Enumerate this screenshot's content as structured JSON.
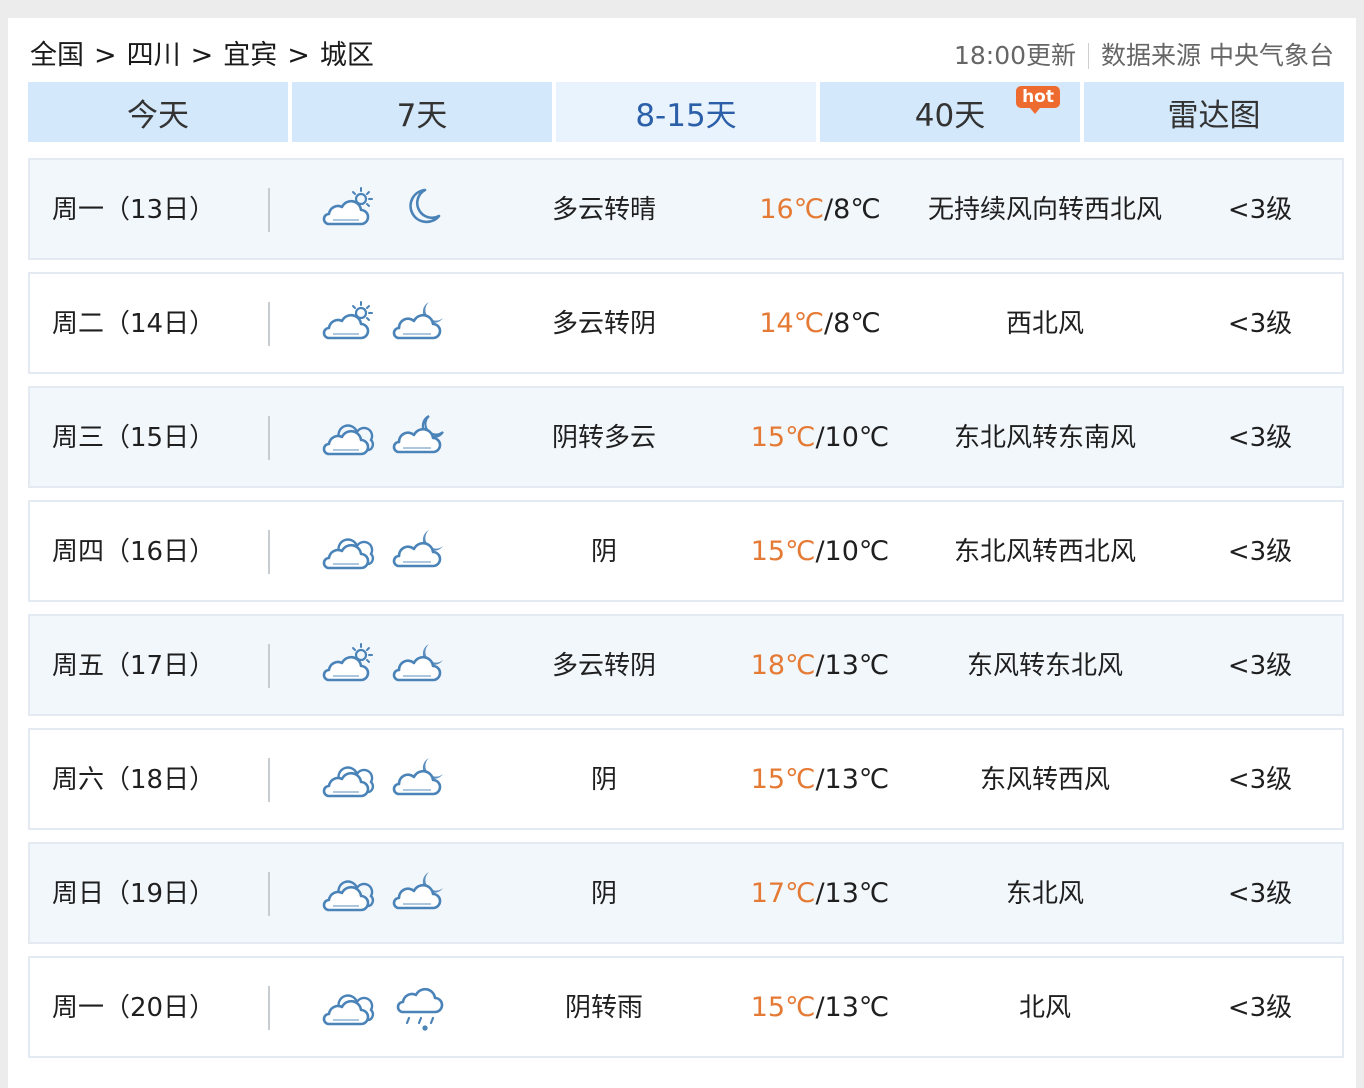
{
  "breadcrumb": {
    "items": [
      "全国",
      "四川",
      "宜宾",
      "城区"
    ],
    "separator": ">"
  },
  "meta": {
    "update": "18:00更新",
    "source": "数据来源 中央气象台"
  },
  "tabs": [
    {
      "label": "今天",
      "active": false
    },
    {
      "label": "7天",
      "active": false
    },
    {
      "label": "8-15天",
      "active": true
    },
    {
      "label": "40天",
      "active": false,
      "badge": "hot"
    },
    {
      "label": "雷达图",
      "active": false
    }
  ],
  "colors": {
    "accent": "#2b5fa8",
    "temp_high": "#e57a35",
    "tab_bg": "#d4e8fb",
    "icon": "#4a83b8"
  },
  "days": [
    {
      "date": "周一（13日）",
      "day_icon": "partly-cloudy-day-icon",
      "night_icon": "moon-icon",
      "desc": "多云转晴",
      "high": "16℃",
      "sep": "/",
      "low": "8℃",
      "wind": "无持续风向转西北风",
      "level": "<3级"
    },
    {
      "date": "周二（14日）",
      "day_icon": "partly-cloudy-day-icon",
      "night_icon": "cloudy-night-icon",
      "desc": "多云转阴",
      "high": "14℃",
      "sep": "/",
      "low": "8℃",
      "wind": "西北风",
      "level": "<3级"
    },
    {
      "date": "周三（15日）",
      "day_icon": "cloudy-icon",
      "night_icon": "partly-cloudy-night-icon",
      "desc": "阴转多云",
      "high": "15℃",
      "sep": "/",
      "low": "10℃",
      "wind": "东北风转东南风",
      "level": "<3级"
    },
    {
      "date": "周四（16日）",
      "day_icon": "cloudy-icon",
      "night_icon": "cloudy-night-icon",
      "desc": "阴",
      "high": "15℃",
      "sep": "/",
      "low": "10℃",
      "wind": "东北风转西北风",
      "level": "<3级"
    },
    {
      "date": "周五（17日）",
      "day_icon": "partly-cloudy-day-icon",
      "night_icon": "cloudy-night-icon",
      "desc": "多云转阴",
      "high": "18℃",
      "sep": "/",
      "low": "13℃",
      "wind": "东风转东北风",
      "level": "<3级"
    },
    {
      "date": "周六（18日）",
      "day_icon": "cloudy-icon",
      "night_icon": "cloudy-night-icon",
      "desc": "阴",
      "high": "15℃",
      "sep": "/",
      "low": "13℃",
      "wind": "东风转西风",
      "level": "<3级"
    },
    {
      "date": "周日（19日）",
      "day_icon": "cloudy-icon",
      "night_icon": "cloudy-night-icon",
      "desc": "阴",
      "high": "17℃",
      "sep": "/",
      "low": "13℃",
      "wind": "东北风",
      "level": "<3级"
    },
    {
      "date": "周一（20日）",
      "day_icon": "cloudy-icon",
      "night_icon": "rain-icon",
      "desc": "阴转雨",
      "high": "15℃",
      "sep": "/",
      "low": "13℃",
      "wind": "北风",
      "level": "<3级"
    }
  ]
}
